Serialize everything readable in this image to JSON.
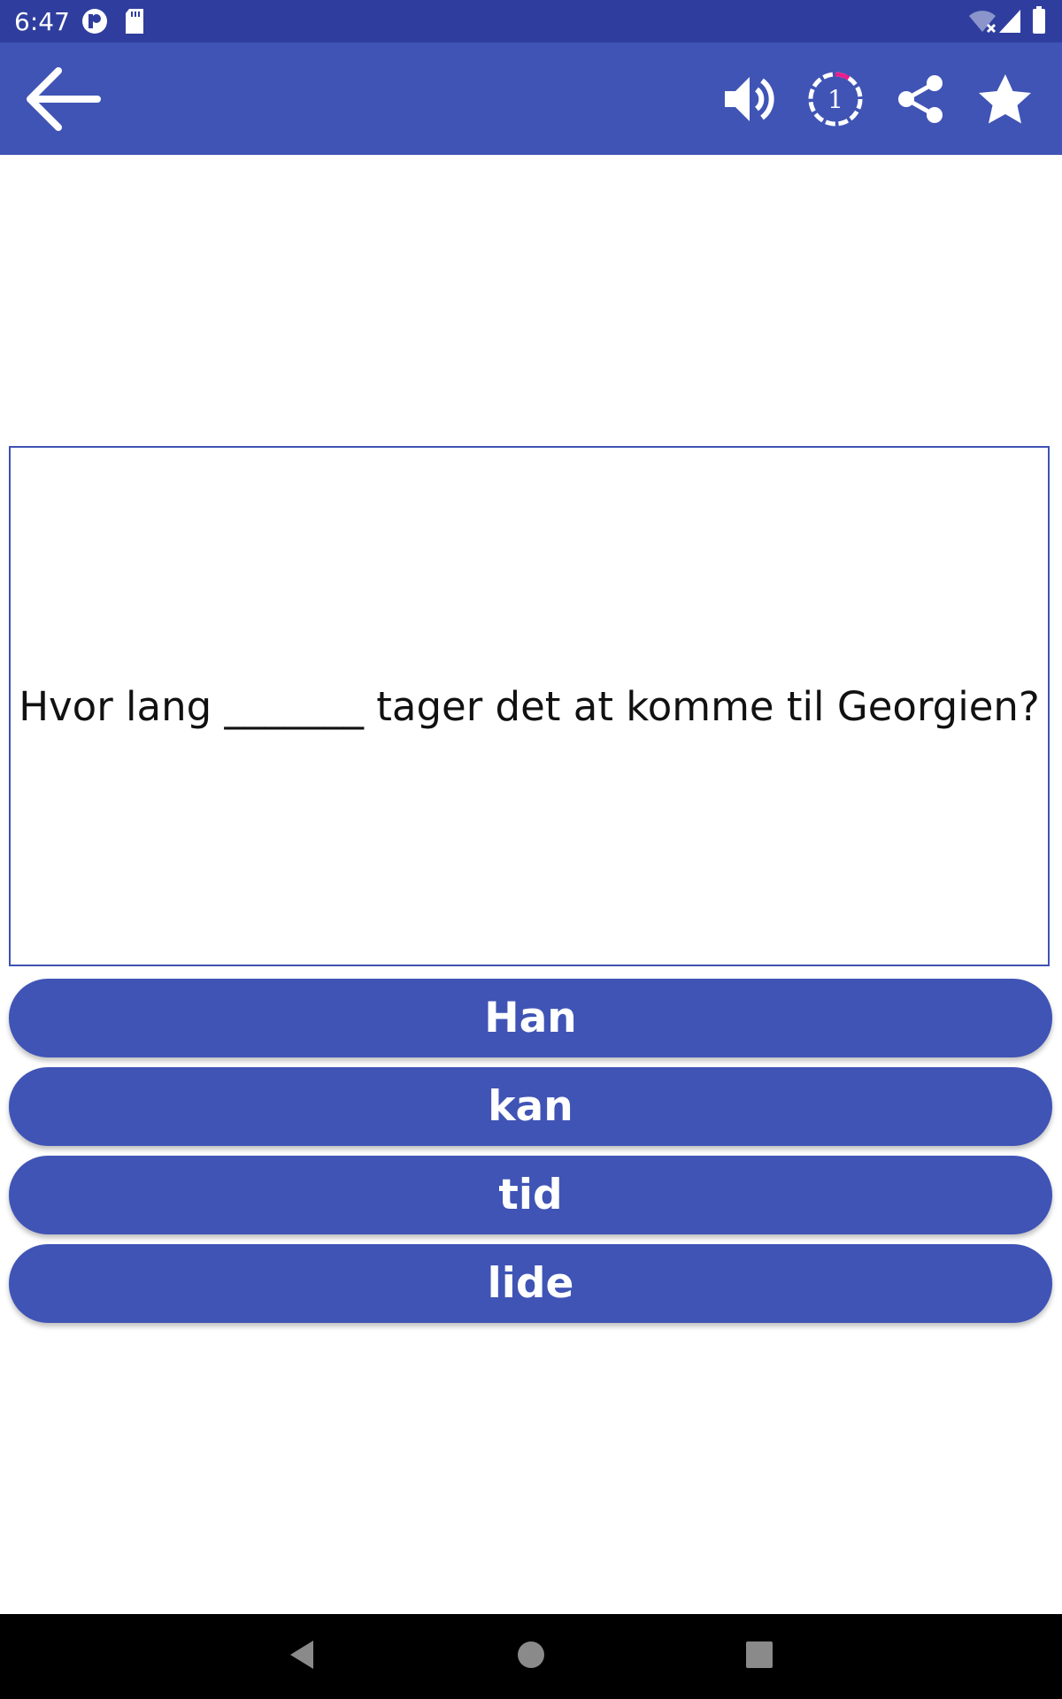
{
  "status_bar": {
    "time": "6:47",
    "icons": [
      "notification-app-icon",
      "sd-card-icon",
      "wifi-off-icon",
      "signal-icon",
      "battery-icon"
    ]
  },
  "toolbar": {
    "back_icon": "arrow-left-icon",
    "actions": [
      "volume-icon",
      "timer-icon",
      "share-icon",
      "star-icon"
    ],
    "timer_value": "1",
    "timer_progress_color": "#e91e8c"
  },
  "question": {
    "text": "Hvor lang _______ tager det at komme til Georgien?"
  },
  "answers": [
    {
      "label": "Han"
    },
    {
      "label": "kan"
    },
    {
      "label": "tid"
    },
    {
      "label": "lide"
    }
  ],
  "colors": {
    "primary": "#4054b5",
    "primary_dark": "#2f3e9e",
    "border": "#3f51b5"
  },
  "navigation_bar": {
    "buttons": [
      "back-nav-icon",
      "home-nav-icon",
      "recents-nav-icon"
    ]
  }
}
